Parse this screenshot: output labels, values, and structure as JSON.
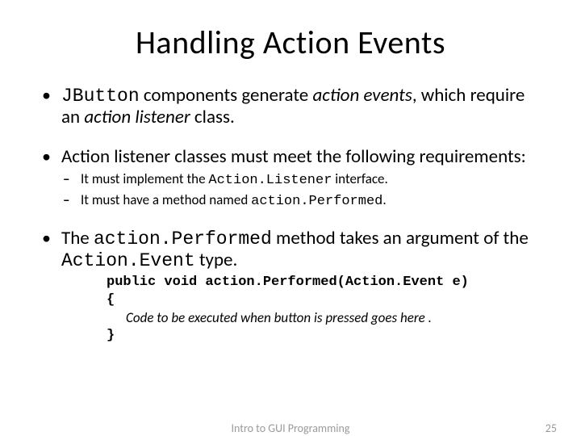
{
  "title": "Handling Action Events",
  "bullets": {
    "b1": {
      "code": "JButton",
      "t1": " components generate ",
      "em1": "action events",
      "t2": ", which require an ",
      "em2": "action listener",
      "t3": " class."
    },
    "b2": {
      "text": "Action listener classes must meet the following requirements:",
      "sub": {
        "s1": {
          "t1": "It must implement the ",
          "code": "Action.Listener",
          "t2": " interface."
        },
        "s2": {
          "t1": "It must have a method named ",
          "code": "action.Performed",
          "t2": "."
        }
      }
    },
    "b3": {
      "t1": "The ",
      "code1": "action.Performed",
      "t2": " method takes an argument of the ",
      "code2": "Action.Event",
      "t3": " type."
    }
  },
  "code": {
    "sig": "public void action.Performed(Action.Event e)",
    "open": "{",
    "comment": "Code to be executed when button is pressed goes here .",
    "close": "}"
  },
  "footer": {
    "title": "Intro to GUI Programming",
    "page": "25"
  }
}
